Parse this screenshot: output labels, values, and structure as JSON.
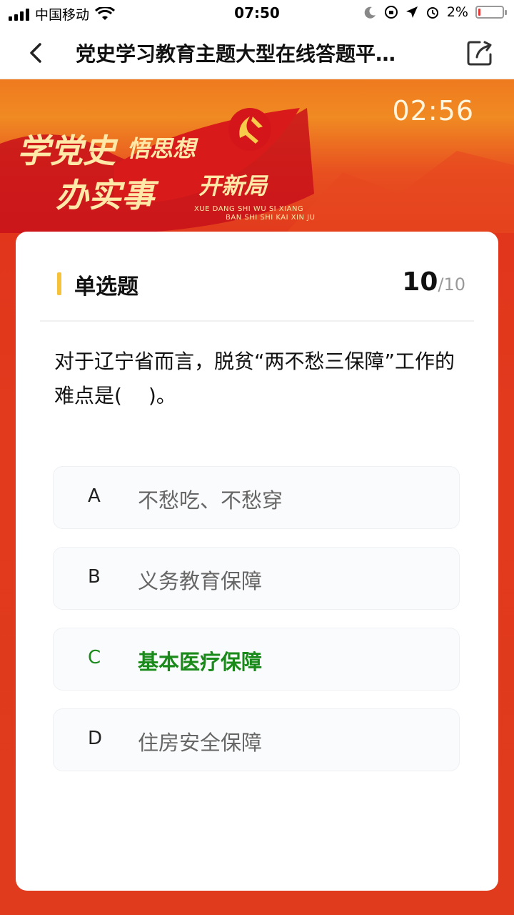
{
  "status_bar": {
    "carrier": "中国移动",
    "time": "07:50",
    "battery": "2%"
  },
  "nav": {
    "title": "党史学习教育主题大型在线答题平…"
  },
  "banner": {
    "timer": "02:56",
    "slogan_line1a": "学党史",
    "slogan_line1b": "悟思想",
    "slogan_line2a": "办实事",
    "slogan_line2b": "开新局",
    "pinyin_line1": "XUE DANG SHI     WU SI XIANG",
    "pinyin_line2": "BAN SHI SHI     KAI XIN JU"
  },
  "card": {
    "question_type": "单选题",
    "question_index": "10",
    "question_total": "/10",
    "question_text": "对于辽宁省而言，脱贫“两不愁三保障”工作的难点是(　 )。",
    "options": [
      {
        "letter": "A",
        "text": "不愁吃、不愁穿"
      },
      {
        "letter": "B",
        "text": "义务教育保障"
      },
      {
        "letter": "C",
        "text": "基本医疗保障"
      },
      {
        "letter": "D",
        "text": "住房安全保障"
      }
    ]
  },
  "colors": {
    "correct": "#1a8a1a",
    "accent_bar": "#f5c23a",
    "background_red": "#e13a1d"
  }
}
